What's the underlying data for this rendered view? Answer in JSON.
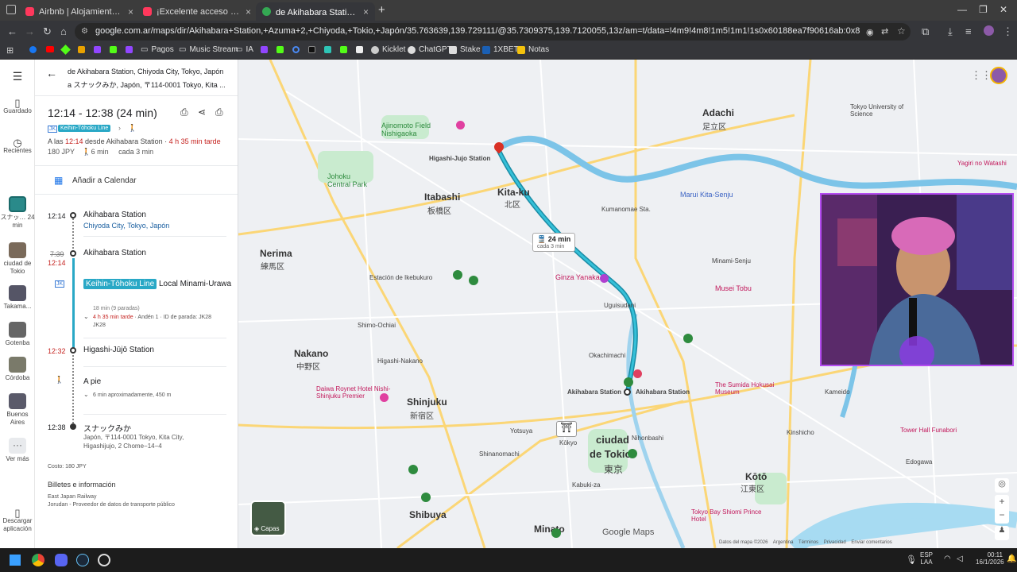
{
  "browser": {
    "tabs": [
      {
        "title": "Airbnb | Alojamientos para vac",
        "favicon_color": "#ff385c",
        "active": false
      },
      {
        "title": "¡Excelente acceso al centro de",
        "favicon_color": "#ff385c",
        "active": false
      },
      {
        "title": "de Akihabara Station a スナックみ",
        "favicon_color": "#34a853",
        "active": true
      }
    ],
    "new_tab_icon": "plus-icon",
    "url": "google.com.ar/maps/dir/Akihabara+Station,+Azuma+2,+Chiyoda,+Tokio,+Japón/35.763639,139.729111/@35.7309375,139.7120055,13z/am=t/data=!4m9!4m8!1m5!1m1!1s0x60188ea7f90616ab:0x8d405f2c427203d5!2m2!1d139.7744106!2d35.6979...",
    "bookmarks": [
      {
        "label": "Pagos",
        "icon": "folder-icon"
      },
      {
        "label": "Music Stream",
        "icon": "folder-icon"
      },
      {
        "label": "IA",
        "icon": "folder-icon"
      },
      {
        "label": "Kicklet",
        "icon": "kicklet-icon"
      },
      {
        "label": "ChatGPT",
        "icon": "chatgpt-icon"
      },
      {
        "label": "Stake",
        "icon": "stake-icon"
      },
      {
        "label": "1XBET",
        "icon": "xbet-icon"
      },
      {
        "label": "Notas",
        "icon": "notes-icon"
      }
    ]
  },
  "rail": {
    "menu_icon": "hamburger-icon",
    "saved_label": "Guardado",
    "recent_label": "Recientes",
    "items": [
      {
        "label": "スナッ… 24 min"
      },
      {
        "label": "ciudad de Tokio"
      },
      {
        "label": "Takama..."
      },
      {
        "label": "Gotenba"
      },
      {
        "label": "Córdoba"
      },
      {
        "label": "Buenos Aires"
      }
    ],
    "more_label": "Ver más",
    "download_label": "Descargar aplicación"
  },
  "panel": {
    "dest_line1": "de Akihabara Station, Chiyoda City, Tokyo, Japón",
    "dest_line2": "a スナックみか, Japón, 〒114-0001 Tokyo, Kita ...",
    "time_range": "12:14 - 12:38 (24 min)",
    "line_badge": "Keihin-Tōhoku Line",
    "summary_prefix": "A las ",
    "summary_time": "12:14",
    "summary_mid": " desde Akihabara Station · ",
    "summary_delay": "4 h 35 min tarde",
    "fare": "180 JPY",
    "walk_short": "6 min",
    "frequency": "cada 3 min",
    "calendar_label": "Añadir a Calendar",
    "steps": {
      "s1_time": "12:14",
      "s1_name": "Akihabara Station",
      "s1_sub": "Chiyoda City, Tokyo, Japón",
      "s2_time_old": "7:39",
      "s2_time_new": "12:14",
      "s2_name": "Akihabara Station",
      "train_line": "Keihin-Tōhoku Line",
      "train_dir": "Local Minami-Urawa",
      "train_stops": "18 min (9 paradas)",
      "train_delay": "4 h 35 min tarde",
      "train_platform": "· Andén 1 · ID de parada: JK28",
      "s3_time": "12:32",
      "s3_name": "Higashi-Jūjō Station",
      "walk_label": "A pie",
      "walk_detail": "6 min aproximadamente, 450 m",
      "s4_time": "12:38",
      "s4_name": "スナックみか",
      "s4_addr1": "Japón, 〒114-0001 Tokyo, Kita City,",
      "s4_addr2": "Higashijujo, 2 Chome−14−4"
    },
    "cost": "Costo: 180 JPY",
    "tickets_title": "Billetes e información",
    "provider1": "East Japan Railway",
    "provider2": "Jorudan - Proveedor de datos de transporte público"
  },
  "map": {
    "labels": [
      {
        "text": "Adachi",
        "cls": "big"
      },
      {
        "text": "足立区",
        "cls": ""
      },
      {
        "text": "Itabashi",
        "cls": "big"
      },
      {
        "text": "板橋区",
        "cls": ""
      },
      {
        "text": "Kita-ku",
        "cls": "big"
      },
      {
        "text": "北区",
        "cls": ""
      },
      {
        "text": "Nerima",
        "cls": "big"
      },
      {
        "text": "練馬区",
        "cls": ""
      },
      {
        "text": "Nakano",
        "cls": "big"
      },
      {
        "text": "中野区",
        "cls": ""
      },
      {
        "text": "Shinjuku",
        "cls": "big"
      },
      {
        "text": "新宿区",
        "cls": ""
      },
      {
        "text": "ciudad",
        "cls": "big"
      },
      {
        "text": "de Tokio",
        "cls": "big"
      },
      {
        "text": "東京",
        "cls": ""
      },
      {
        "text": "Kōtō",
        "cls": "big"
      },
      {
        "text": "江東区",
        "cls": ""
      },
      {
        "text": "Minato",
        "cls": "big"
      },
      {
        "text": "Shibuya",
        "cls": "big"
      },
      {
        "text": "Higashi-Jujo Station",
        "cls": ""
      },
      {
        "text": "Akihabara Station",
        "cls": ""
      },
      {
        "text": "Akihabara Station",
        "cls": ""
      },
      {
        "text": "Kumanomae Sta.",
        "cls": ""
      },
      {
        "text": "Minami-Senju",
        "cls": ""
      },
      {
        "text": "Musei Tobu",
        "cls": "pink"
      },
      {
        "text": "Ginza Yanaka",
        "cls": "pink"
      },
      {
        "text": "Uguisudani",
        "cls": ""
      },
      {
        "text": "Okachimachi",
        "cls": ""
      },
      {
        "text": "Estación de Ikebukuro",
        "cls": ""
      },
      {
        "text": "Higashi-Nakano",
        "cls": ""
      },
      {
        "text": "Shimo-Ochiai",
        "cls": ""
      },
      {
        "text": "Daiwa Roynet Hotel Nishi-Shinjuku Premier",
        "cls": "pink"
      },
      {
        "text": "The Sumida Hokusai Museum",
        "cls": "pink"
      },
      {
        "text": "Tower Hall Funabori",
        "cls": "pink"
      },
      {
        "text": "Tokyo Bay Shiomi Prince Hotel",
        "cls": "pink"
      },
      {
        "text": "Johoku Central Park",
        "cls": "park"
      },
      {
        "text": "Ajinomoto Field Nishigaoka",
        "cls": "park"
      },
      {
        "text": "Marui Kita-Senju",
        "cls": "blue"
      },
      {
        "text": "Kabuki-za",
        "cls": ""
      },
      {
        "text": "Kōkyo",
        "cls": ""
      },
      {
        "text": "Yotsuya",
        "cls": ""
      },
      {
        "text": "Shinanomachi",
        "cls": ""
      },
      {
        "text": "Nihonbashi",
        "cls": ""
      },
      {
        "text": "Kameido",
        "cls": ""
      },
      {
        "text": "Edogawa",
        "cls": ""
      },
      {
        "text": "Yagiri no Watashi",
        "cls": "pink"
      },
      {
        "text": "Tokyo University of Science",
        "cls": ""
      },
      {
        "text": "Kinshicho",
        "cls": ""
      }
    ],
    "route_badge_time": "24 min",
    "route_badge_freq": "cada 3 min",
    "layers_label": "Capas",
    "watermark": "Google Maps",
    "attribution": "Datos del mapa ©2026    Argentina    Términos    Privacidad    Enviar comentarios"
  },
  "taskbar": {
    "lang": "ESP",
    "lang2": "LAA",
    "time": "00:11",
    "date": "16/1/2026"
  }
}
